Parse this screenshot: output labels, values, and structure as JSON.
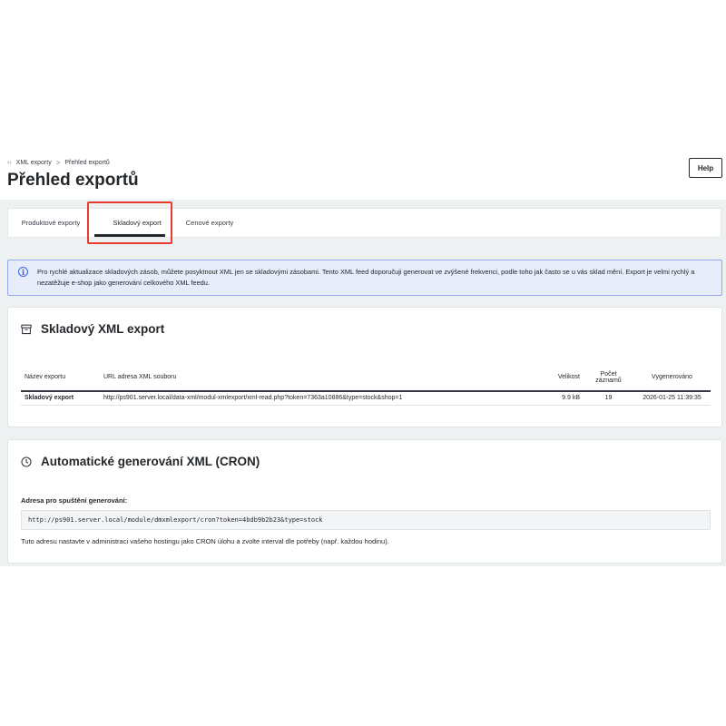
{
  "header": {
    "breadcrumb": {
      "icon": "code-icon",
      "parent": "XML exporty",
      "separator": ">",
      "current": "Přehled exportů"
    },
    "title": "Přehled exportů",
    "help_label": "Help"
  },
  "tabs": [
    {
      "label": "Produktové exporty",
      "active": false
    },
    {
      "label": "Skladový export",
      "active": true
    },
    {
      "label": "Cenové exporty",
      "active": false
    }
  ],
  "alert": {
    "icon": "info-icon",
    "text": "Pro rychlé aktualizace skladových zásob, můžete posyktnout XML jen se skladovými zásobami. Tento XML feed doporučuji generovat ve zvýšené frekvenci, podle toho jak často se u vás sklad mění. Export je velmi rychlý a nezatěžuje e-shop jako generování celkového XML feedu."
  },
  "export_card": {
    "icon": "archive-icon",
    "title": "Skladový XML export",
    "columns": {
      "name": "Název exportu",
      "url": "URL adresa XML souboru",
      "size": "Velikost",
      "count": "Počet záznamů",
      "generated": "Vygenerováno"
    },
    "rows": [
      {
        "name": "Skladový export",
        "url": "http://ps901.server.local/data-xml/modul-xmlexport/xml-read.php?token=7363a10886&type=stock&shop=1",
        "size": "9.9 kB",
        "count": "19",
        "generated": "2026-01-25 11:39:35"
      }
    ]
  },
  "cron_card": {
    "icon": "clock-icon",
    "title": "Automatické generování XML (CRON)",
    "label": "Adresa pro spuštění generování:",
    "url": "http://ps901.server.local/module/dmxmlexport/cron?token=4bdb9b2b23&type=stock",
    "help": "Tuto adresu nastavte v administraci vašeho hostingu jako CRON úlohu a zvolte interval dle potřeby (např. každou hodinu)."
  },
  "colors": {
    "accent_highlight": "#e63b2e",
    "alert_border": "#91a8f2",
    "alert_bg": "#e7ecfb",
    "info_blue": "#3b5fe0"
  }
}
